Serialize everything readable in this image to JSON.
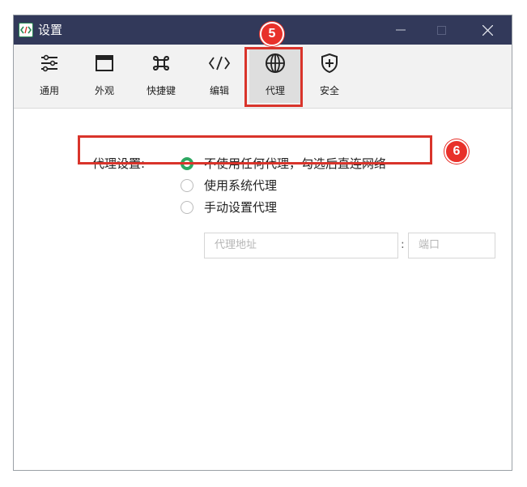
{
  "window": {
    "title": "设置"
  },
  "toolbar": {
    "items": [
      {
        "label": "通用",
        "icon": "sliders-icon"
      },
      {
        "label": "外观",
        "icon": "window-icon"
      },
      {
        "label": "快捷键",
        "icon": "command-key-icon"
      },
      {
        "label": "编辑",
        "icon": "code-icon"
      },
      {
        "label": "代理",
        "icon": "globe-icon",
        "active": true
      },
      {
        "label": "安全",
        "icon": "shield-plus-icon"
      }
    ]
  },
  "annotations": {
    "badge_toolbar": "5",
    "badge_option": "6"
  },
  "proxy": {
    "label": "代理设置:",
    "options": [
      {
        "label": "不使用任何代理，勾选后直连网络",
        "checked": true
      },
      {
        "label": "使用系统代理",
        "checked": false
      },
      {
        "label": "手动设置代理",
        "checked": false
      }
    ],
    "address_placeholder": "代理地址",
    "separator": ":",
    "port_placeholder": "端口"
  },
  "colors": {
    "titlebar": "#32395a",
    "accent_radio": "#2ea862",
    "highlight": "#d9342b"
  }
}
